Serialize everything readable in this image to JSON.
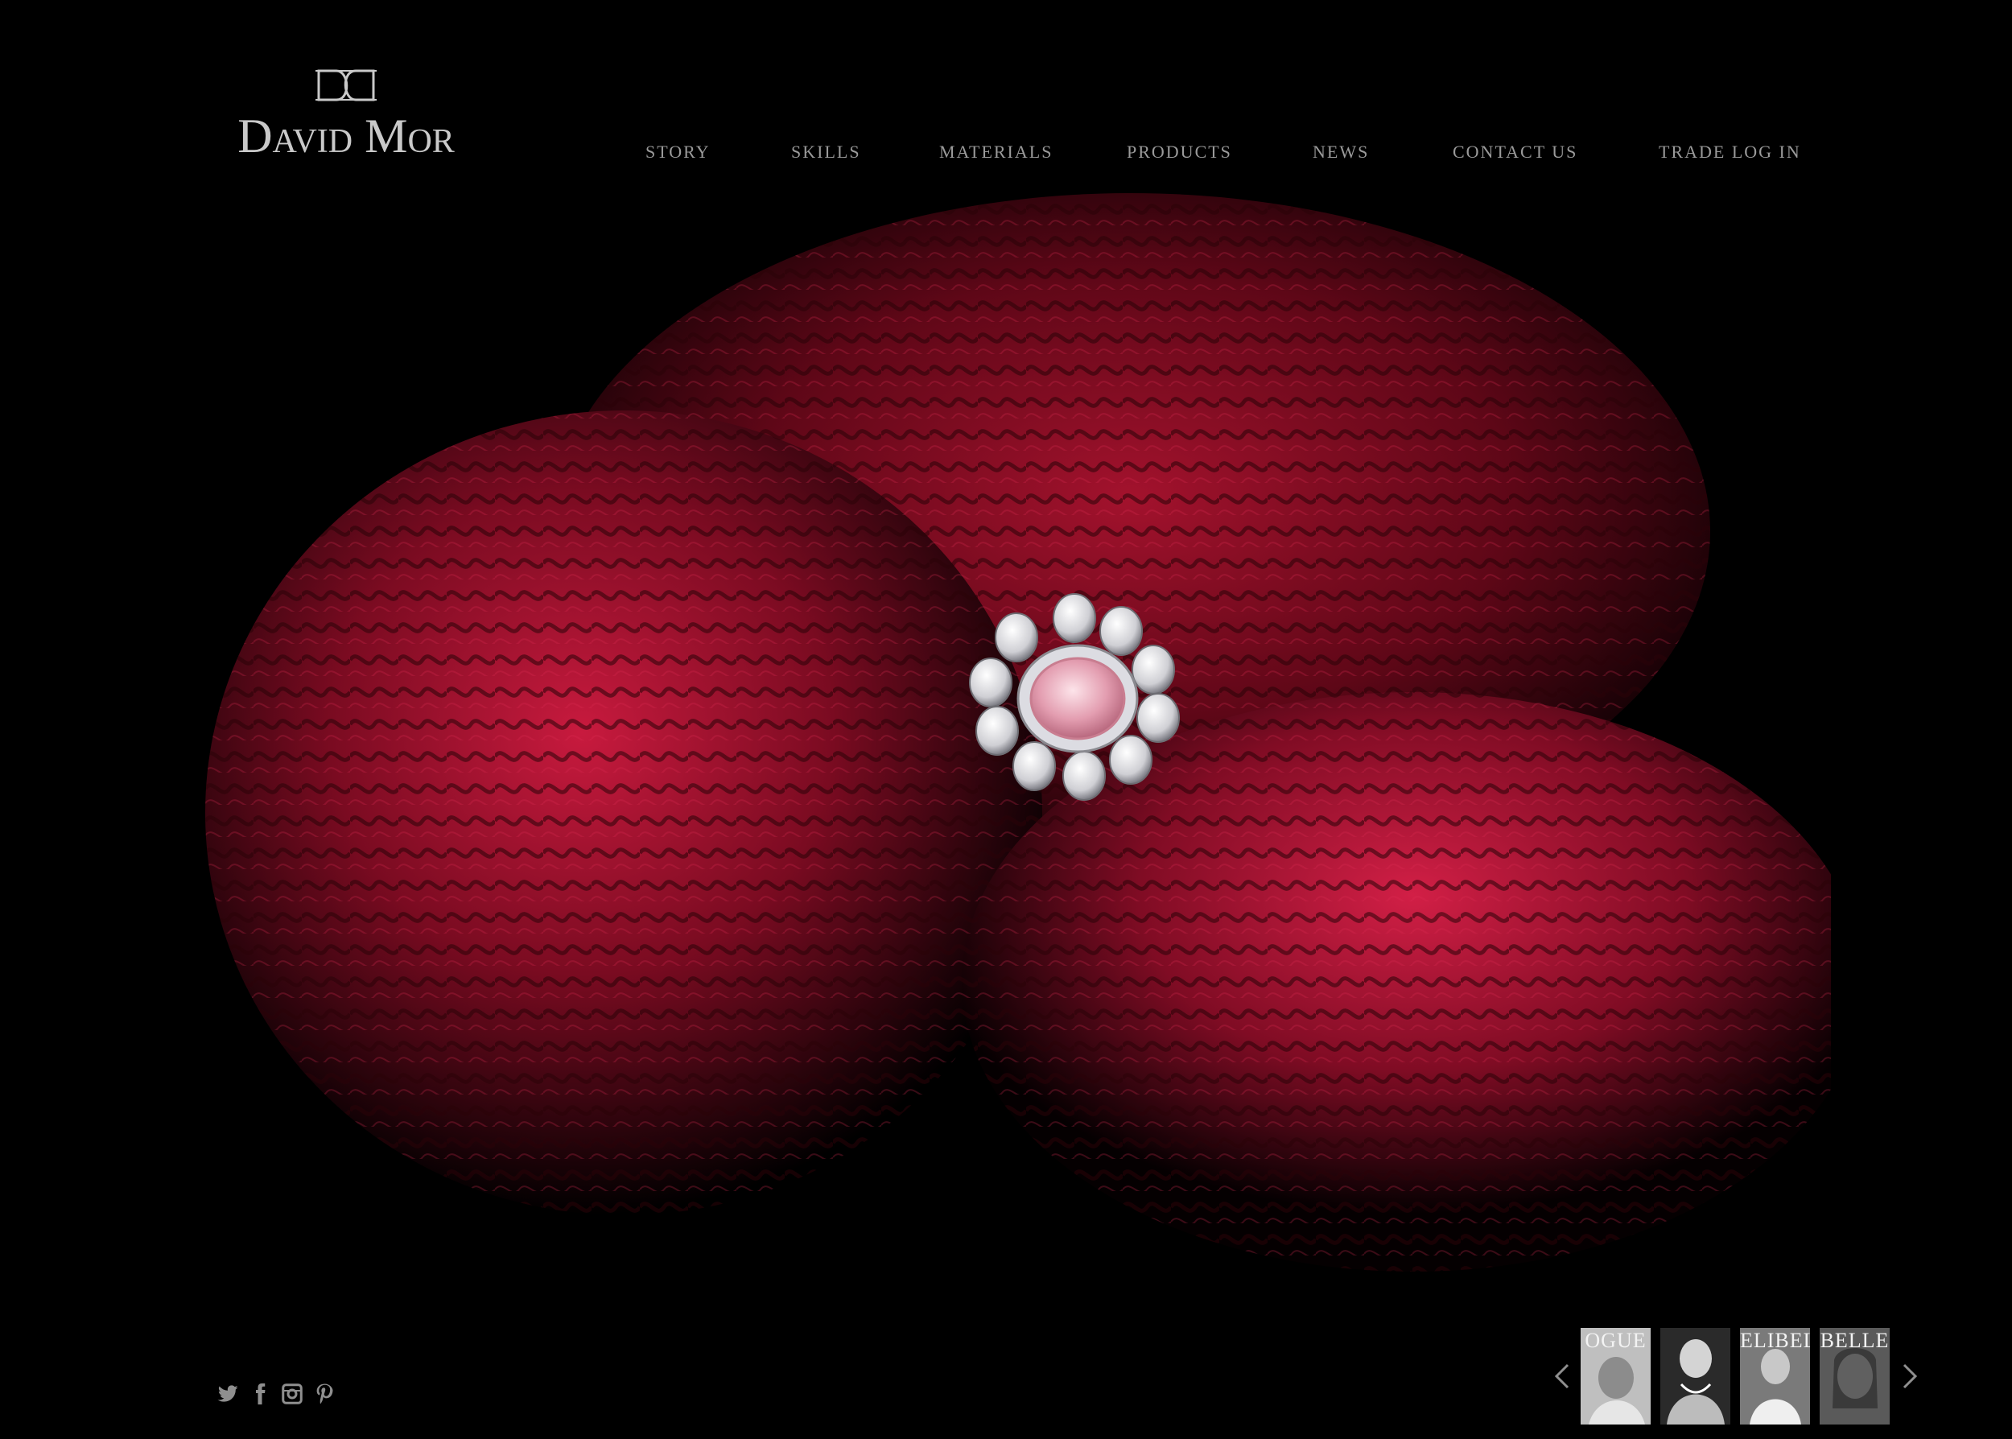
{
  "brand": {
    "monogram": "DD",
    "name": "David Mor"
  },
  "nav": {
    "items": [
      {
        "label": "STORY"
      },
      {
        "label": "SKILLS"
      },
      {
        "label": "MATERIALS"
      },
      {
        "label": "PRODUCTS"
      },
      {
        "label": "NEWS"
      },
      {
        "label": "CONTACT US"
      },
      {
        "label": "TRADE LOG IN"
      }
    ]
  },
  "hero": {
    "image": "red celosia flowers with pink diamond ring",
    "colors": {
      "background": "#000000",
      "flower": "#8a0d22",
      "flower_highlight": "#c01a3c",
      "stone": "#f0b9c6"
    }
  },
  "social": {
    "icons": [
      "twitter-icon",
      "facebook-icon",
      "instagram-icon",
      "pinterest-icon"
    ]
  },
  "press": {
    "prev_icon": "chevron-left-icon",
    "next_icon": "chevron-right-icon",
    "thumbnails": [
      {
        "title": "OGUE",
        "kind": "magazine-cover"
      },
      {
        "title": "",
        "kind": "portrait"
      },
      {
        "title": "ELIBELLE",
        "kind": "magazine-cover"
      },
      {
        "title": "BELLE",
        "kind": "magazine-cover"
      }
    ]
  },
  "colors": {
    "text_nav": "#9a9a9a",
    "logo": "#c9c9c9",
    "background": "#000000"
  }
}
